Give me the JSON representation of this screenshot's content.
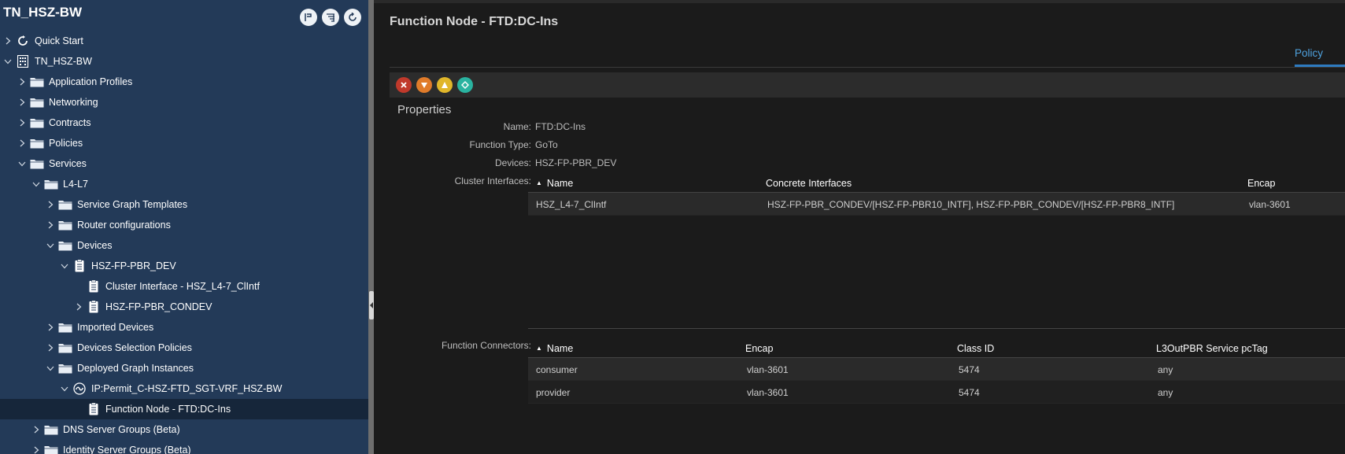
{
  "sidebar": {
    "title": "TN_HSZ-BW",
    "tools": [
      "pin-icon",
      "filter-list-icon",
      "refresh-icon"
    ],
    "items": [
      {
        "label": "Quick Start",
        "level": 0,
        "expanded": false,
        "icon": "quick-start-icon"
      },
      {
        "label": "TN_HSZ-BW",
        "level": 0,
        "expanded": true,
        "icon": "tenant-grid-icon"
      },
      {
        "label": "Application Profiles",
        "level": 1,
        "expanded": false,
        "icon": "folder-icon"
      },
      {
        "label": "Networking",
        "level": 1,
        "expanded": false,
        "icon": "folder-icon"
      },
      {
        "label": "Contracts",
        "level": 1,
        "expanded": false,
        "icon": "folder-icon"
      },
      {
        "label": "Policies",
        "level": 1,
        "expanded": false,
        "icon": "folder-icon"
      },
      {
        "label": "Services",
        "level": 1,
        "expanded": true,
        "icon": "folder-icon"
      },
      {
        "label": "L4-L7",
        "level": 2,
        "expanded": true,
        "icon": "folder-icon"
      },
      {
        "label": "Service Graph Templates",
        "level": 3,
        "expanded": false,
        "icon": "folder-icon"
      },
      {
        "label": "Router configurations",
        "level": 3,
        "expanded": false,
        "icon": "folder-icon"
      },
      {
        "label": "Devices",
        "level": 3,
        "expanded": true,
        "icon": "folder-icon"
      },
      {
        "label": "HSZ-FP-PBR_DEV",
        "level": 4,
        "expanded": true,
        "icon": "document-icon"
      },
      {
        "label": "Cluster Interface - HSZ_L4-7_ClIntf",
        "level": 5,
        "leaf": true,
        "icon": "document-icon"
      },
      {
        "label": "HSZ-FP-PBR_CONDEV",
        "level": 5,
        "expanded": false,
        "icon": "document-icon"
      },
      {
        "label": "Imported Devices",
        "level": 3,
        "expanded": false,
        "icon": "folder-icon"
      },
      {
        "label": "Devices Selection Policies",
        "level": 3,
        "expanded": false,
        "icon": "folder-icon"
      },
      {
        "label": "Deployed Graph Instances",
        "level": 3,
        "expanded": true,
        "icon": "folder-icon"
      },
      {
        "label": "IP:Permit_C-HSZ-FTD_SGT-VRF_HSZ-BW",
        "level": 4,
        "expanded": true,
        "icon": "graph-instance-icon"
      },
      {
        "label": "Function Node - FTD:DC-Ins",
        "level": 5,
        "leaf": true,
        "icon": "document-icon",
        "selected": true
      },
      {
        "label": "DNS Server Groups (Beta)",
        "level": 2,
        "expanded": false,
        "icon": "folder-icon"
      },
      {
        "label": "Identity Server Groups (Beta)",
        "level": 2,
        "expanded": false,
        "icon": "folder-icon"
      }
    ]
  },
  "main": {
    "title": "Function Node - FTD:DC-Ins",
    "tabs": [
      {
        "label": "Policy",
        "active": true
      }
    ],
    "toolbar_icons": [
      {
        "name": "critical-fault-icon",
        "color": "#c0392b"
      },
      {
        "name": "major-fault-icon",
        "color": "#e07b2a"
      },
      {
        "name": "minor-fault-icon",
        "color": "#e0b62a"
      },
      {
        "name": "warning-fault-icon",
        "color": "#2ab3a0"
      }
    ],
    "section_title": "Properties",
    "properties": {
      "name_label": "Name:",
      "name_value": "FTD:DC-Ins",
      "function_type_label": "Function Type:",
      "function_type_value": "GoTo",
      "devices_label": "Devices:",
      "devices_value": "HSZ-FP-PBR_DEV",
      "cluster_interfaces_label": "Cluster Interfaces:",
      "function_connectors_label": "Function Connectors:"
    },
    "cluster_interfaces": {
      "columns": [
        "Name",
        "Concrete Interfaces",
        "Encap"
      ],
      "rows": [
        [
          "HSZ_L4-7_ClIntf",
          "HSZ-FP-PBR_CONDEV/[HSZ-FP-PBR10_INTF], HSZ-FP-PBR_CONDEV/[HSZ-FP-PBR8_INTF]",
          "vlan-3601"
        ]
      ]
    },
    "function_connectors": {
      "columns": [
        "Name",
        "Encap",
        "Class ID",
        "L3OutPBR Service pcTag"
      ],
      "rows": [
        [
          "consumer",
          "vlan-3601",
          "5474",
          "any"
        ],
        [
          "provider",
          "vlan-3601",
          "5474",
          "any"
        ]
      ]
    }
  }
}
